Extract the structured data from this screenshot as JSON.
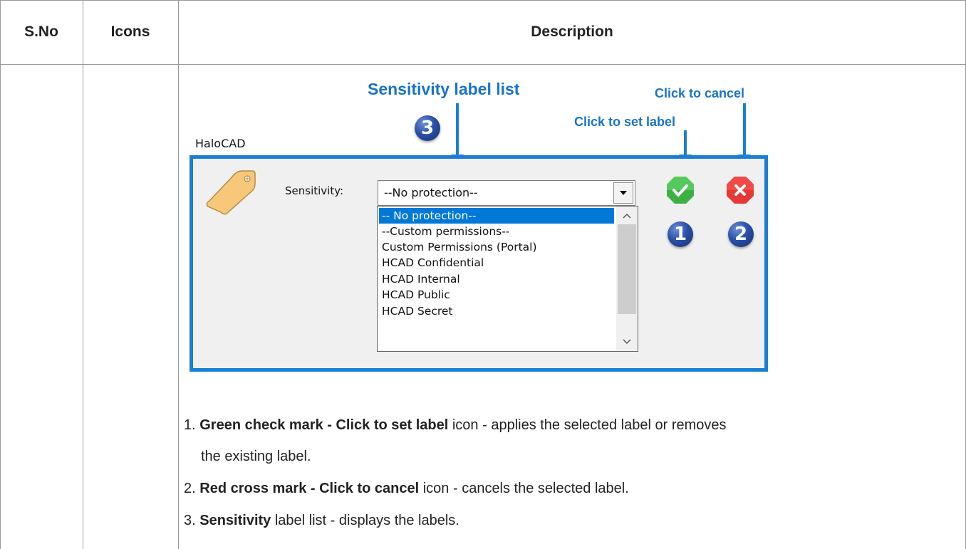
{
  "table": {
    "headers": {
      "sno": "S.No",
      "icons": "Icons",
      "description": "Description"
    }
  },
  "screenshot": {
    "callouts": {
      "sensitivity_list": "Sensitivity label list",
      "set_label": "Click to set label",
      "cancel": "Click to cancel"
    },
    "badges": {
      "one": "1",
      "two": "2",
      "three": "3"
    },
    "app_title": "HaloCAD",
    "sensitivity_label": "Sensitivity:",
    "combo_value": "--No protection--",
    "options": [
      "-- No protection--",
      "--Custom permissions--",
      "Custom Permissions (Portal)",
      "HCAD Confidential",
      "HCAD Internal",
      "HCAD Public",
      "HCAD Secret"
    ],
    "icons": {
      "tag": "tag-icon",
      "ok": "check-icon",
      "cancel": "close-icon"
    },
    "colors": {
      "accent": "#1a7fd4",
      "callout": "#1a73c8",
      "selected": "#0078d7",
      "ok": "#3cb043",
      "cancel": "#e53935"
    }
  },
  "steps": [
    {
      "num": "1.",
      "bold": "Green check mark - Click to set label",
      "rest": " icon - applies the selected label or removes",
      "cont": "the existing label."
    },
    {
      "num": "2.",
      "bold": "Red cross mark - Click to cancel",
      "rest": " icon - cancels the selected label."
    },
    {
      "num": "3.",
      "bold": "Sensitivity",
      "rest": " label list - displays the labels."
    }
  ]
}
